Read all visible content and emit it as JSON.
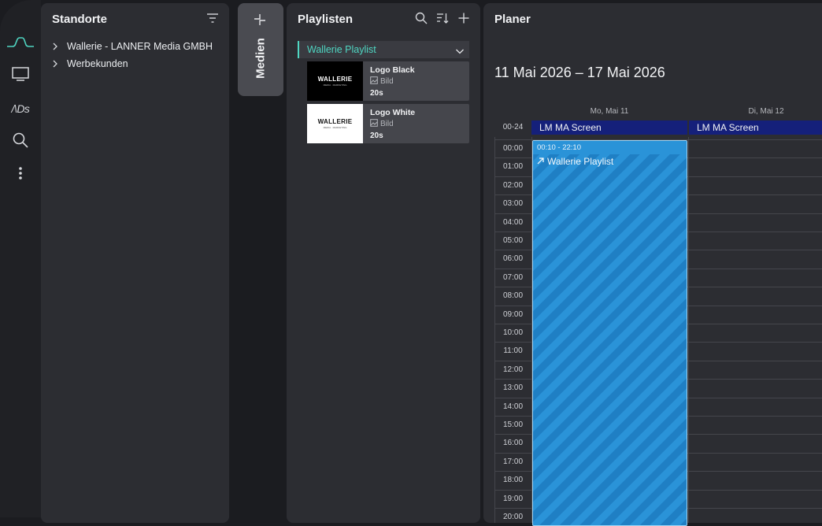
{
  "colors": {
    "accent": "#4fd6c2",
    "event_blue": "#2a93d8",
    "screen_bar": "#15207a"
  },
  "rail": {
    "items": [
      {
        "icon": "wave-icon"
      },
      {
        "icon": "monitor-icon"
      },
      {
        "icon": "ads-logo-icon",
        "label": "/\\Ds"
      },
      {
        "icon": "search-icon"
      },
      {
        "icon": "more-vertical-icon"
      }
    ]
  },
  "standorte": {
    "title": "Standorte",
    "items": [
      {
        "label": "Wallerie - LANNER Media GMBH"
      },
      {
        "label": "Werbekunden"
      }
    ]
  },
  "medien": {
    "label": "Medien"
  },
  "playlisten": {
    "title": "Playlisten",
    "playlist": {
      "name": "Wallerie Playlist",
      "items": [
        {
          "name": "Logo Black",
          "type": "Bild",
          "duration": "20s",
          "thumb_text": "WALLERIE",
          "thumb_sub": "MEDIA · MARKETING",
          "thumb_bg": "#000000",
          "thumb_fg": "#ffffff"
        },
        {
          "name": "Logo White",
          "type": "Bild",
          "duration": "20s",
          "thumb_text": "WALLERIE",
          "thumb_sub": "MEDIA · MARKETING",
          "thumb_bg": "#ffffff",
          "thumb_fg": "#111111"
        }
      ]
    }
  },
  "planer": {
    "title": "Planer",
    "date_range": "11 Mai 2026 – 17 Mai 2026",
    "allday_label": "00-24",
    "days": [
      {
        "label": "Mo, Mai 11",
        "screen": "LM MA Screen"
      },
      {
        "label": "Di, Mai 12",
        "screen": "LM MA Screen"
      }
    ],
    "hours": [
      "00:00",
      "01:00",
      "02:00",
      "03:00",
      "04:00",
      "05:00",
      "06:00",
      "07:00",
      "08:00",
      "09:00",
      "10:00",
      "11:00",
      "12:00",
      "13:00",
      "14:00",
      "15:00",
      "16:00",
      "17:00",
      "18:00",
      "19:00",
      "20:00"
    ],
    "event": {
      "time": "00:10 - 22:10",
      "title": "Wallerie Playlist"
    }
  }
}
